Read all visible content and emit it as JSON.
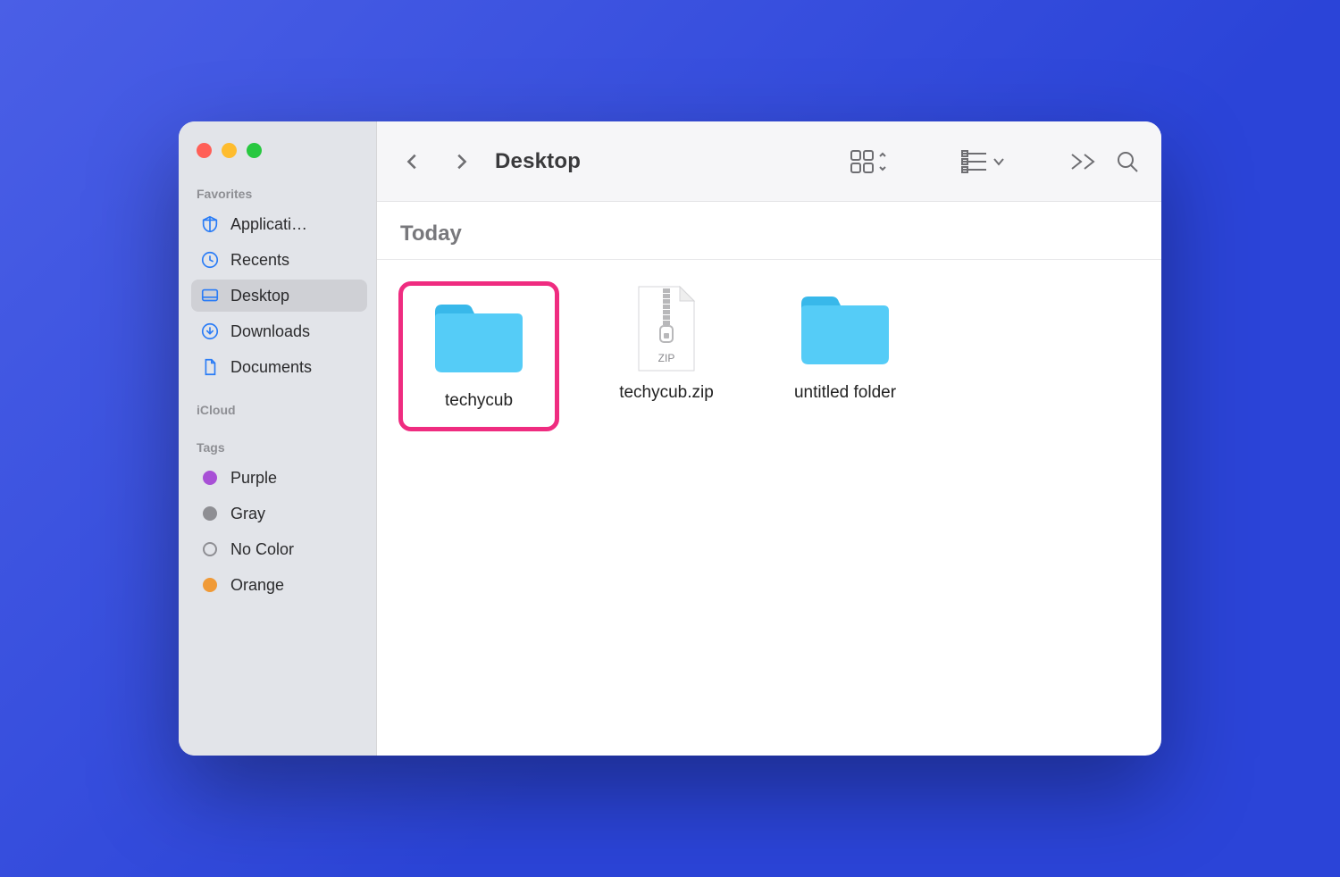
{
  "window": {
    "title": "Desktop"
  },
  "sidebar": {
    "sections": {
      "favorites": {
        "label": "Favorites",
        "items": [
          {
            "label": "Applicati…"
          },
          {
            "label": "Recents"
          },
          {
            "label": "Desktop"
          },
          {
            "label": "Downloads"
          },
          {
            "label": "Documents"
          }
        ]
      },
      "icloud": {
        "label": "iCloud"
      },
      "tags": {
        "label": "Tags",
        "items": [
          {
            "label": "Purple"
          },
          {
            "label": "Gray"
          },
          {
            "label": "No Color"
          },
          {
            "label": "Orange"
          }
        ]
      }
    }
  },
  "content": {
    "section_header": "Today",
    "items": [
      {
        "name": "techycub",
        "type": "folder",
        "highlighted": true
      },
      {
        "name": "techycub.zip",
        "type": "zip",
        "highlighted": false
      },
      {
        "name": "untitled folder",
        "type": "folder",
        "highlighted": false
      }
    ]
  }
}
